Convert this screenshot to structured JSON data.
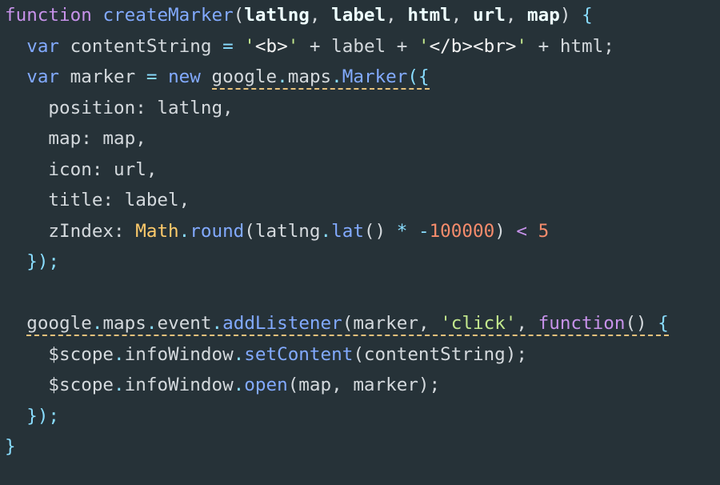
{
  "editor": {
    "background": "#263238",
    "warning_underline_color": "#e5c07b",
    "lines": [
      [
        {
          "t": "function",
          "c": "kw"
        },
        {
          "t": " ",
          "c": "plain"
        },
        {
          "t": "createMarker",
          "c": "fn"
        },
        {
          "t": "(",
          "c": "plain"
        },
        {
          "t": "latlng",
          "c": "bold"
        },
        {
          "t": ", ",
          "c": "plain"
        },
        {
          "t": "label",
          "c": "bold"
        },
        {
          "t": ", ",
          "c": "plain"
        },
        {
          "t": "html",
          "c": "bold"
        },
        {
          "t": ", ",
          "c": "plain"
        },
        {
          "t": "url",
          "c": "bold"
        },
        {
          "t": ", ",
          "c": "plain"
        },
        {
          "t": "map",
          "c": "bold"
        },
        {
          "t": ") ",
          "c": "plain"
        },
        {
          "t": "{",
          "c": "punc"
        }
      ],
      [
        {
          "t": "  ",
          "c": "plain"
        },
        {
          "t": "var",
          "c": "decl"
        },
        {
          "t": " contentString ",
          "c": "plain"
        },
        {
          "t": "=",
          "c": "op"
        },
        {
          "t": " ",
          "c": "plain"
        },
        {
          "t": "'",
          "c": "str"
        },
        {
          "t": "<b>",
          "c": "tag"
        },
        {
          "t": "'",
          "c": "str"
        },
        {
          "t": " + label + ",
          "c": "plain"
        },
        {
          "t": "'",
          "c": "str"
        },
        {
          "t": "</b><br>",
          "c": "tag"
        },
        {
          "t": "'",
          "c": "str"
        },
        {
          "t": " + html;",
          "c": "plain"
        }
      ],
      [
        {
          "t": "  ",
          "c": "plain"
        },
        {
          "t": "var",
          "c": "decl"
        },
        {
          "t": " marker ",
          "c": "plain"
        },
        {
          "t": "=",
          "c": "op"
        },
        {
          "t": " ",
          "c": "plain"
        },
        {
          "t": "new",
          "c": "decl"
        },
        {
          "t": " ",
          "c": "plain"
        },
        {
          "t": "google.maps.Marker({",
          "c": "plain",
          "warn": true,
          "parts": [
            {
              "t": "google",
              "c": "plain"
            },
            {
              "t": ".",
              "c": "punc"
            },
            {
              "t": "maps",
              "c": "plain"
            },
            {
              "t": ".",
              "c": "punc"
            },
            {
              "t": "Marker",
              "c": "fn"
            },
            {
              "t": "({",
              "c": "punc"
            }
          ]
        }
      ],
      [
        {
          "t": "    position: latlng,",
          "c": "plain"
        }
      ],
      [
        {
          "t": "    map: map,",
          "c": "plain"
        }
      ],
      [
        {
          "t": "    icon: url,",
          "c": "plain"
        }
      ],
      [
        {
          "t": "    title: label,",
          "c": "plain"
        }
      ],
      [
        {
          "t": "    zIndex: ",
          "c": "plain"
        },
        {
          "t": "Math",
          "c": "global"
        },
        {
          "t": ".",
          "c": "punc"
        },
        {
          "t": "round",
          "c": "fn"
        },
        {
          "t": "(latlng",
          "c": "plain"
        },
        {
          "t": ".",
          "c": "punc"
        },
        {
          "t": "lat",
          "c": "fn"
        },
        {
          "t": "() ",
          "c": "plain"
        },
        {
          "t": "*",
          "c": "op"
        },
        {
          "t": " ",
          "c": "plain"
        },
        {
          "t": "-",
          "c": "op"
        },
        {
          "t": "100000",
          "c": "num"
        },
        {
          "t": ") ",
          "c": "plain"
        },
        {
          "t": "<",
          "c": "cmp"
        },
        {
          "t": " ",
          "c": "plain"
        },
        {
          "t": "5",
          "c": "num"
        }
      ],
      [
        {
          "t": "  ",
          "c": "plain"
        },
        {
          "t": "});",
          "c": "punc"
        }
      ],
      [],
      [
        {
          "t": "  ",
          "c": "plain"
        },
        {
          "t": "google.maps.event.addListener(marker, 'click', function() {",
          "c": "plain",
          "warn": true,
          "parts": [
            {
              "t": "google",
              "c": "plain"
            },
            {
              "t": ".",
              "c": "punc"
            },
            {
              "t": "maps",
              "c": "plain"
            },
            {
              "t": ".",
              "c": "punc"
            },
            {
              "t": "event",
              "c": "plain"
            },
            {
              "t": ".",
              "c": "punc"
            },
            {
              "t": "addListener",
              "c": "fn"
            },
            {
              "t": "(marker, ",
              "c": "plain"
            },
            {
              "t": "'click'",
              "c": "str"
            },
            {
              "t": ", ",
              "c": "plain"
            },
            {
              "t": "function",
              "c": "kw"
            },
            {
              "t": "() ",
              "c": "plain"
            },
            {
              "t": "{",
              "c": "punc"
            }
          ]
        }
      ],
      [
        {
          "t": "    $scope",
          "c": "plain"
        },
        {
          "t": ".",
          "c": "punc"
        },
        {
          "t": "infoWindow",
          "c": "plain"
        },
        {
          "t": ".",
          "c": "punc"
        },
        {
          "t": "setContent",
          "c": "fn"
        },
        {
          "t": "(contentString);",
          "c": "plain"
        }
      ],
      [
        {
          "t": "    $scope",
          "c": "plain"
        },
        {
          "t": ".",
          "c": "punc"
        },
        {
          "t": "infoWindow",
          "c": "plain"
        },
        {
          "t": ".",
          "c": "punc"
        },
        {
          "t": "open",
          "c": "fn"
        },
        {
          "t": "(map, marker);",
          "c": "plain"
        }
      ],
      [
        {
          "t": "  ",
          "c": "plain"
        },
        {
          "t": "});",
          "c": "punc"
        }
      ],
      [
        {
          "t": "}",
          "c": "punc"
        }
      ]
    ]
  }
}
